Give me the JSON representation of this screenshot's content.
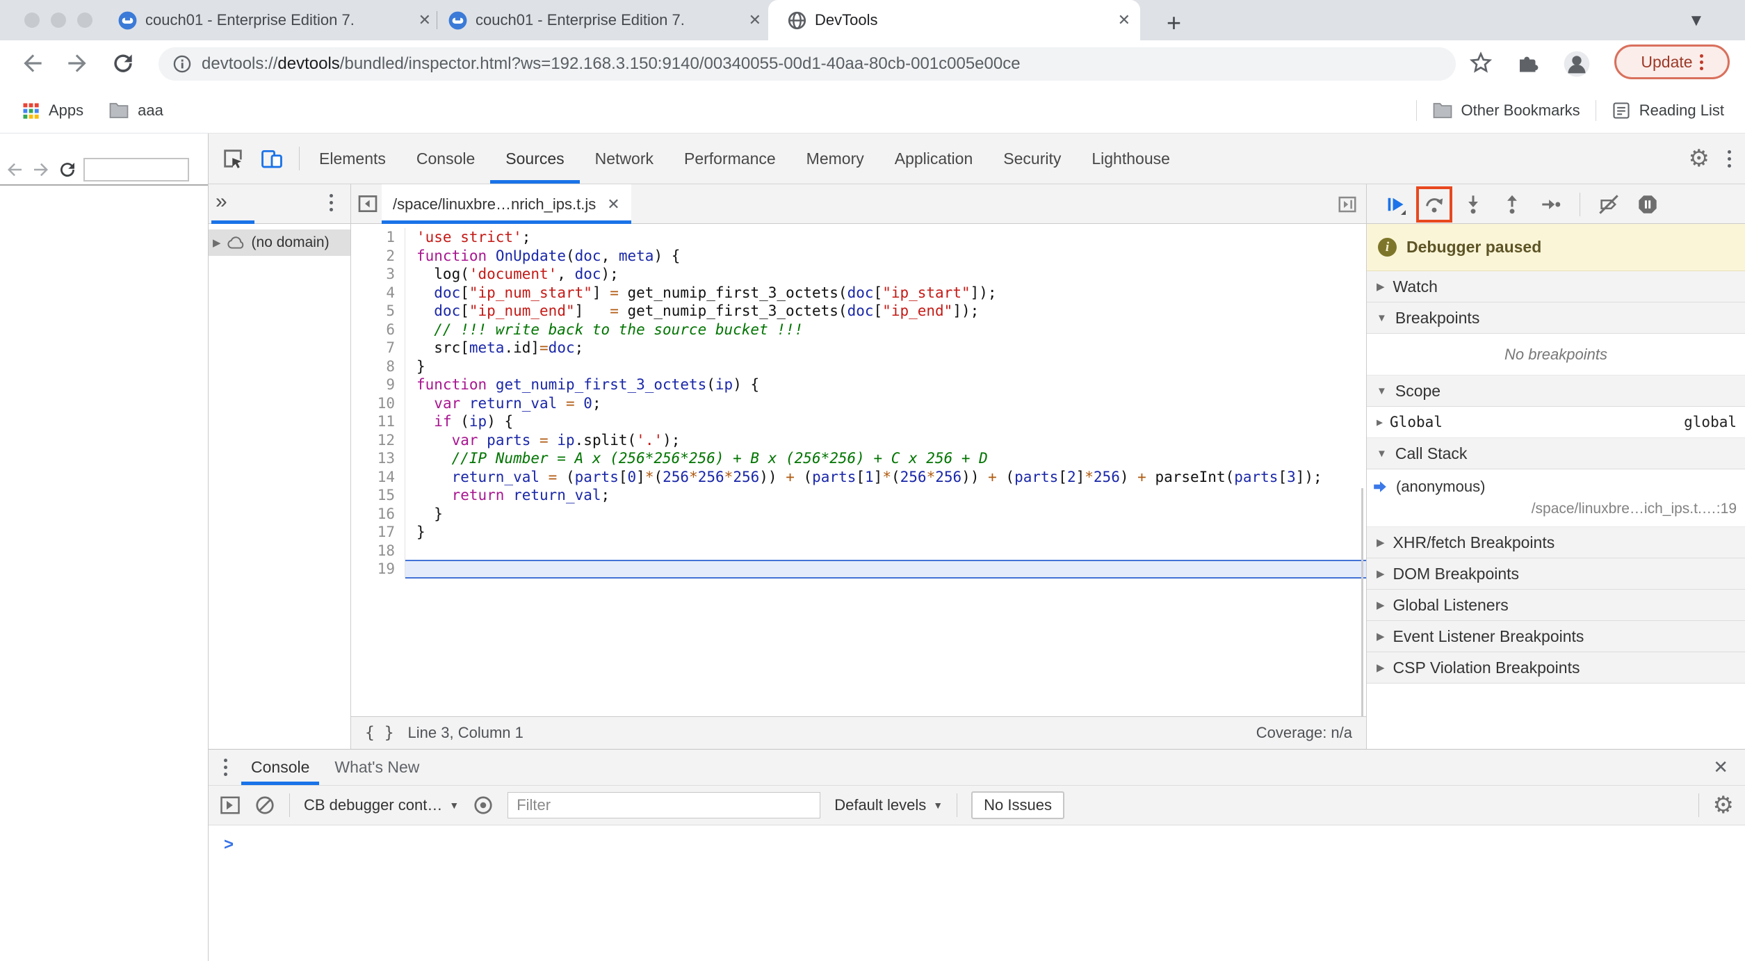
{
  "browser": {
    "window_controls": [
      "close",
      "minimize",
      "zoom"
    ],
    "tabs": [
      {
        "title": "couch01 - Enterprise Edition 7.",
        "icon": "couchbase-icon",
        "active": false
      },
      {
        "title": "couch01 - Enterprise Edition 7.",
        "icon": "couchbase-icon",
        "active": false
      },
      {
        "title": "DevTools",
        "icon": "globe-icon",
        "active": true
      }
    ],
    "new_tab_label": "+",
    "url": {
      "scheme": "devtools://",
      "host": "devtools",
      "rest": "/bundled/inspector.html?ws=192.168.3.150:9140/00340055-00d1-40aa-80cb-001c005e00ce"
    },
    "update_label": "Update",
    "bookmarks_left": [
      "Apps",
      "aaa"
    ],
    "bookmarks_right": [
      "Other Bookmarks",
      "Reading List"
    ]
  },
  "devtools": {
    "tabs": [
      "Elements",
      "Console",
      "Sources",
      "Network",
      "Performance",
      "Memory",
      "Application",
      "Security",
      "Lighthouse"
    ],
    "active_tab": "Sources",
    "navigator": {
      "overflow": "»",
      "item": "(no domain)"
    },
    "file_tab": "/space/linuxbre…nrich_ips.t.js",
    "status_bar": {
      "position": "Line 3, Column 1",
      "coverage": "Coverage: n/a"
    },
    "debugger": {
      "paused_label": "Debugger paused",
      "sections": [
        {
          "label": "Watch",
          "expanded": false
        },
        {
          "label": "Breakpoints",
          "expanded": true
        },
        {
          "label": "Scope",
          "expanded": true
        },
        {
          "label": "Call Stack",
          "expanded": true
        },
        {
          "label": "XHR/fetch Breakpoints",
          "expanded": false
        },
        {
          "label": "DOM Breakpoints",
          "expanded": false
        },
        {
          "label": "Global Listeners",
          "expanded": false
        },
        {
          "label": "Event Listener Breakpoints",
          "expanded": false
        },
        {
          "label": "CSP Violation Breakpoints",
          "expanded": false
        }
      ],
      "no_breakpoints": "No breakpoints",
      "scope_name": "Global",
      "scope_value": "global",
      "callstack_fn": "(anonymous)",
      "callstack_loc": "/space/linuxbre…ich_ips.t.…:19"
    },
    "code": {
      "highlight_line": 19,
      "lines": [
        [
          [
            "s",
            "'use strict'"
          ],
          [
            "p",
            ";"
          ]
        ],
        [
          [
            "k",
            "function"
          ],
          [
            "p",
            " "
          ],
          [
            "v",
            "OnUpdate"
          ],
          [
            "p",
            "("
          ],
          [
            "v",
            "doc"
          ],
          [
            "p",
            ", "
          ],
          [
            "v",
            "meta"
          ],
          [
            "p",
            ") {"
          ]
        ],
        [
          [
            "p",
            "  log("
          ],
          [
            "s",
            "'document'"
          ],
          [
            "p",
            ", "
          ],
          [
            "v",
            "doc"
          ],
          [
            "p",
            ");"
          ]
        ],
        [
          [
            "p",
            "  "
          ],
          [
            "v",
            "doc"
          ],
          [
            "p",
            "["
          ],
          [
            "s",
            "\"ip_num_start\""
          ],
          [
            "p",
            "] "
          ],
          [
            "o",
            "="
          ],
          [
            "p",
            " get_numip_first_3_octets("
          ],
          [
            "v",
            "doc"
          ],
          [
            "p",
            "["
          ],
          [
            "s",
            "\"ip_start\""
          ],
          [
            "p",
            "]);"
          ]
        ],
        [
          [
            "p",
            "  "
          ],
          [
            "v",
            "doc"
          ],
          [
            "p",
            "["
          ],
          [
            "s",
            "\"ip_num_end\""
          ],
          [
            "p",
            "]   "
          ],
          [
            "o",
            "="
          ],
          [
            "p",
            " get_numip_first_3_octets("
          ],
          [
            "v",
            "doc"
          ],
          [
            "p",
            "["
          ],
          [
            "s",
            "\"ip_end\""
          ],
          [
            "p",
            "]);"
          ]
        ],
        [
          [
            "c",
            "  // !!! write back to the source bucket !!!"
          ]
        ],
        [
          [
            "p",
            "  src["
          ],
          [
            "v",
            "meta"
          ],
          [
            "p",
            ".id]"
          ],
          [
            "o",
            "="
          ],
          [
            "v",
            "doc"
          ],
          [
            "p",
            ";"
          ]
        ],
        [
          [
            "p",
            "}"
          ]
        ],
        [
          [
            "k",
            "function"
          ],
          [
            "p",
            " "
          ],
          [
            "v",
            "get_numip_first_3_octets"
          ],
          [
            "p",
            "("
          ],
          [
            "v",
            "ip"
          ],
          [
            "p",
            ") {"
          ]
        ],
        [
          [
            "p",
            "  "
          ],
          [
            "k",
            "var"
          ],
          [
            "p",
            " "
          ],
          [
            "v",
            "return_val"
          ],
          [
            "p",
            " "
          ],
          [
            "o",
            "="
          ],
          [
            "p",
            " "
          ],
          [
            "v",
            "0"
          ],
          [
            "p",
            ";"
          ]
        ],
        [
          [
            "p",
            "  "
          ],
          [
            "k",
            "if"
          ],
          [
            "p",
            " ("
          ],
          [
            "v",
            "ip"
          ],
          [
            "p",
            ") {"
          ]
        ],
        [
          [
            "p",
            "    "
          ],
          [
            "k",
            "var"
          ],
          [
            "p",
            " "
          ],
          [
            "v",
            "parts"
          ],
          [
            "p",
            " "
          ],
          [
            "o",
            "="
          ],
          [
            "p",
            " "
          ],
          [
            "v",
            "ip"
          ],
          [
            "p",
            ".split("
          ],
          [
            "s",
            "'.'"
          ],
          [
            "p",
            ");"
          ]
        ],
        [
          [
            "c",
            "    //IP Number = A x (256*256*256) + B x (256*256) + C x 256 + D"
          ]
        ],
        [
          [
            "p",
            "    "
          ],
          [
            "v",
            "return_val"
          ],
          [
            "p",
            " "
          ],
          [
            "o",
            "="
          ],
          [
            "p",
            " ("
          ],
          [
            "v",
            "parts"
          ],
          [
            "p",
            "["
          ],
          [
            "v",
            "0"
          ],
          [
            "p",
            "]"
          ],
          [
            "o",
            "*"
          ],
          [
            "p",
            "("
          ],
          [
            "v",
            "256"
          ],
          [
            "o",
            "*"
          ],
          [
            "v",
            "256"
          ],
          [
            "o",
            "*"
          ],
          [
            "v",
            "256"
          ],
          [
            "p",
            ")) "
          ],
          [
            "o",
            "+"
          ],
          [
            "p",
            " ("
          ],
          [
            "v",
            "parts"
          ],
          [
            "p",
            "["
          ],
          [
            "v",
            "1"
          ],
          [
            "p",
            "]"
          ],
          [
            "o",
            "*"
          ],
          [
            "p",
            "("
          ],
          [
            "v",
            "256"
          ],
          [
            "o",
            "*"
          ],
          [
            "v",
            "256"
          ],
          [
            "p",
            ")) "
          ],
          [
            "o",
            "+"
          ],
          [
            "p",
            " ("
          ],
          [
            "v",
            "parts"
          ],
          [
            "p",
            "["
          ],
          [
            "v",
            "2"
          ],
          [
            "p",
            "]"
          ],
          [
            "o",
            "*"
          ],
          [
            "v",
            "256"
          ],
          [
            "p",
            ") "
          ],
          [
            "o",
            "+"
          ],
          [
            "p",
            " parseInt("
          ],
          [
            "v",
            "parts"
          ],
          [
            "p",
            "["
          ],
          [
            "v",
            "3"
          ],
          [
            "p",
            "]);"
          ]
        ],
        [
          [
            "p",
            "    "
          ],
          [
            "k",
            "return"
          ],
          [
            "p",
            " "
          ],
          [
            "v",
            "return_val"
          ],
          [
            "p",
            ";"
          ]
        ],
        [
          [
            "p",
            "  }"
          ]
        ],
        [
          [
            "p",
            "}"
          ]
        ],
        [],
        []
      ]
    },
    "drawer": {
      "tabs": [
        "Console",
        "What's New"
      ],
      "active_tab": "Console",
      "context_selector": "CB debugger cont…",
      "filter_placeholder": "Filter",
      "levels_label": "Default levels",
      "no_issues_label": "No Issues"
    }
  },
  "icons": {
    "couchbase-icon": "blue circle with white cup",
    "globe-icon": "globe",
    "step-over-icon": "arc arrow over dot",
    "resume-icon": "blue play with bar",
    "gear-icon": "⚙"
  },
  "colors": {
    "accent_blue": "#1a73e8",
    "paused_bg": "#fbf5d8",
    "annotation_red": "#e8481f",
    "update_border": "#d9705c",
    "highlight_line_bg": "#e4ecfc"
  }
}
